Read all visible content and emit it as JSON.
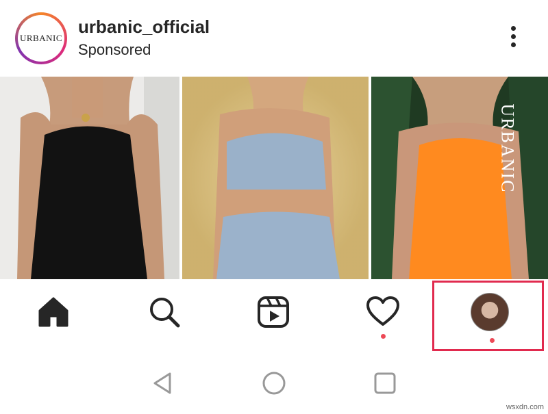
{
  "post": {
    "logo_text": "URBANIC",
    "account_name": "urbanic_official",
    "subtitle": "Sponsored"
  },
  "photos": [
    {
      "description_icon": "photo-black-dress"
    },
    {
      "description_icon": "photo-blue-set"
    },
    {
      "description_icon": "photo-orange-dress",
      "watermark": "URBANIC"
    }
  ],
  "nav": {
    "items": [
      "home-icon",
      "search-icon",
      "reels-icon",
      "activity-heart-icon",
      "profile-avatar"
    ]
  },
  "footer": {
    "site": "wsxdn.com"
  },
  "colors": {
    "notification_dot": "#ed4956",
    "highlight": "#e12a4e"
  }
}
